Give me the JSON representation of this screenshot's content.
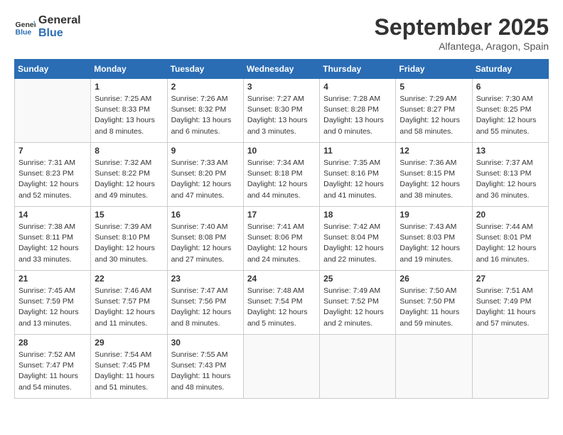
{
  "header": {
    "logo_line1": "General",
    "logo_line2": "Blue",
    "month_title": "September 2025",
    "location": "Alfantega, Aragon, Spain"
  },
  "weekdays": [
    "Sunday",
    "Monday",
    "Tuesday",
    "Wednesday",
    "Thursday",
    "Friday",
    "Saturday"
  ],
  "weeks": [
    [
      {
        "day": "",
        "info": ""
      },
      {
        "day": "1",
        "info": "Sunrise: 7:25 AM\nSunset: 8:33 PM\nDaylight: 13 hours\nand 8 minutes."
      },
      {
        "day": "2",
        "info": "Sunrise: 7:26 AM\nSunset: 8:32 PM\nDaylight: 13 hours\nand 6 minutes."
      },
      {
        "day": "3",
        "info": "Sunrise: 7:27 AM\nSunset: 8:30 PM\nDaylight: 13 hours\nand 3 minutes."
      },
      {
        "day": "4",
        "info": "Sunrise: 7:28 AM\nSunset: 8:28 PM\nDaylight: 13 hours\nand 0 minutes."
      },
      {
        "day": "5",
        "info": "Sunrise: 7:29 AM\nSunset: 8:27 PM\nDaylight: 12 hours\nand 58 minutes."
      },
      {
        "day": "6",
        "info": "Sunrise: 7:30 AM\nSunset: 8:25 PM\nDaylight: 12 hours\nand 55 minutes."
      }
    ],
    [
      {
        "day": "7",
        "info": "Sunrise: 7:31 AM\nSunset: 8:23 PM\nDaylight: 12 hours\nand 52 minutes."
      },
      {
        "day": "8",
        "info": "Sunrise: 7:32 AM\nSunset: 8:22 PM\nDaylight: 12 hours\nand 49 minutes."
      },
      {
        "day": "9",
        "info": "Sunrise: 7:33 AM\nSunset: 8:20 PM\nDaylight: 12 hours\nand 47 minutes."
      },
      {
        "day": "10",
        "info": "Sunrise: 7:34 AM\nSunset: 8:18 PM\nDaylight: 12 hours\nand 44 minutes."
      },
      {
        "day": "11",
        "info": "Sunrise: 7:35 AM\nSunset: 8:16 PM\nDaylight: 12 hours\nand 41 minutes."
      },
      {
        "day": "12",
        "info": "Sunrise: 7:36 AM\nSunset: 8:15 PM\nDaylight: 12 hours\nand 38 minutes."
      },
      {
        "day": "13",
        "info": "Sunrise: 7:37 AM\nSunset: 8:13 PM\nDaylight: 12 hours\nand 36 minutes."
      }
    ],
    [
      {
        "day": "14",
        "info": "Sunrise: 7:38 AM\nSunset: 8:11 PM\nDaylight: 12 hours\nand 33 minutes."
      },
      {
        "day": "15",
        "info": "Sunrise: 7:39 AM\nSunset: 8:10 PM\nDaylight: 12 hours\nand 30 minutes."
      },
      {
        "day": "16",
        "info": "Sunrise: 7:40 AM\nSunset: 8:08 PM\nDaylight: 12 hours\nand 27 minutes."
      },
      {
        "day": "17",
        "info": "Sunrise: 7:41 AM\nSunset: 8:06 PM\nDaylight: 12 hours\nand 24 minutes."
      },
      {
        "day": "18",
        "info": "Sunrise: 7:42 AM\nSunset: 8:04 PM\nDaylight: 12 hours\nand 22 minutes."
      },
      {
        "day": "19",
        "info": "Sunrise: 7:43 AM\nSunset: 8:03 PM\nDaylight: 12 hours\nand 19 minutes."
      },
      {
        "day": "20",
        "info": "Sunrise: 7:44 AM\nSunset: 8:01 PM\nDaylight: 12 hours\nand 16 minutes."
      }
    ],
    [
      {
        "day": "21",
        "info": "Sunrise: 7:45 AM\nSunset: 7:59 PM\nDaylight: 12 hours\nand 13 minutes."
      },
      {
        "day": "22",
        "info": "Sunrise: 7:46 AM\nSunset: 7:57 PM\nDaylight: 12 hours\nand 11 minutes."
      },
      {
        "day": "23",
        "info": "Sunrise: 7:47 AM\nSunset: 7:56 PM\nDaylight: 12 hours\nand 8 minutes."
      },
      {
        "day": "24",
        "info": "Sunrise: 7:48 AM\nSunset: 7:54 PM\nDaylight: 12 hours\nand 5 minutes."
      },
      {
        "day": "25",
        "info": "Sunrise: 7:49 AM\nSunset: 7:52 PM\nDaylight: 12 hours\nand 2 minutes."
      },
      {
        "day": "26",
        "info": "Sunrise: 7:50 AM\nSunset: 7:50 PM\nDaylight: 11 hours\nand 59 minutes."
      },
      {
        "day": "27",
        "info": "Sunrise: 7:51 AM\nSunset: 7:49 PM\nDaylight: 11 hours\nand 57 minutes."
      }
    ],
    [
      {
        "day": "28",
        "info": "Sunrise: 7:52 AM\nSunset: 7:47 PM\nDaylight: 11 hours\nand 54 minutes."
      },
      {
        "day": "29",
        "info": "Sunrise: 7:54 AM\nSunset: 7:45 PM\nDaylight: 11 hours\nand 51 minutes."
      },
      {
        "day": "30",
        "info": "Sunrise: 7:55 AM\nSunset: 7:43 PM\nDaylight: 11 hours\nand 48 minutes."
      },
      {
        "day": "",
        "info": ""
      },
      {
        "day": "",
        "info": ""
      },
      {
        "day": "",
        "info": ""
      },
      {
        "day": "",
        "info": ""
      }
    ]
  ]
}
